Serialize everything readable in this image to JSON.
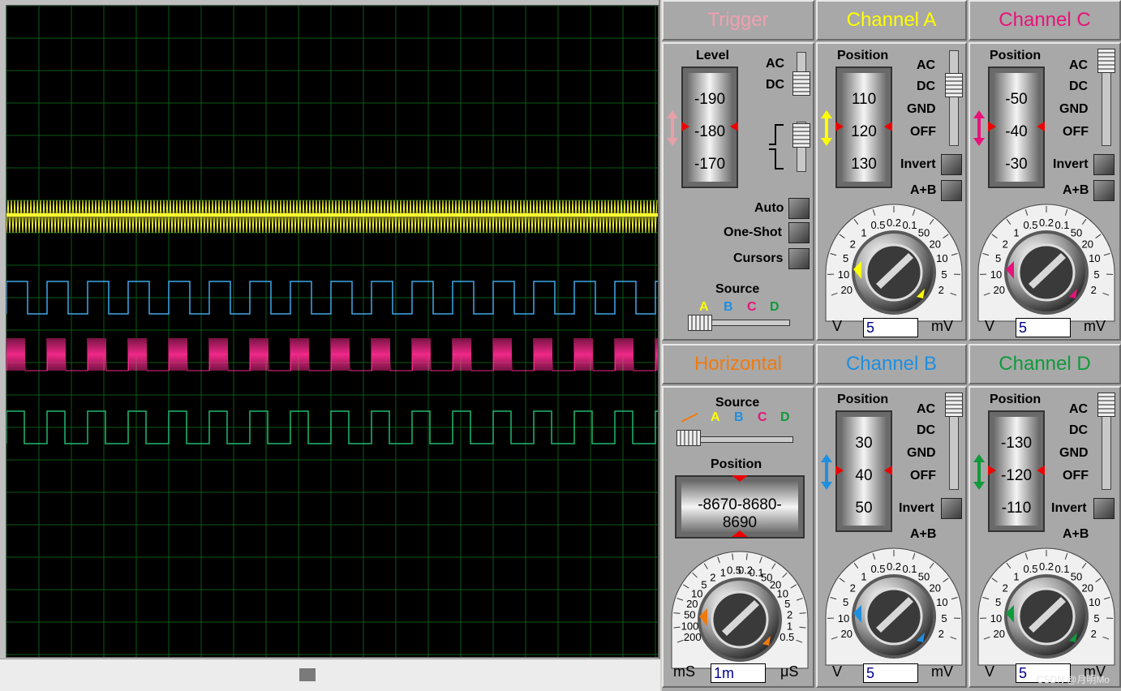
{
  "trigger": {
    "title": "Trigger",
    "level_label": "Level",
    "drum_values": [
      "-190",
      "-180",
      "-170"
    ],
    "coupling": [
      "AC",
      "DC"
    ],
    "buttons": [
      "Auto",
      "One-Shot",
      "Cursors"
    ],
    "source_label": "Source",
    "sources": [
      "A",
      "B",
      "C",
      "D"
    ]
  },
  "horizontal": {
    "title": "Horizontal",
    "source_label": "Source",
    "sources": [
      "A",
      "B",
      "C",
      "D"
    ],
    "position_label": "Position",
    "position_readout": "-8670-8680-8690",
    "dial_labels": [
      "200",
      "100",
      "50",
      "20",
      "10",
      "5",
      "2",
      "1",
      "0.5",
      "0.2",
      "0.1",
      "50",
      "20",
      "10",
      "5",
      "2",
      "1",
      "0.5"
    ],
    "unit_left": "mS",
    "unit_right": "μS",
    "value": "1m"
  },
  "channels": [
    {
      "name": "Channel A",
      "color": "#ffff00",
      "position_label": "Position",
      "drum_values": [
        "110",
        "120",
        "130"
      ],
      "coupling": [
        "AC",
        "DC",
        "GND",
        "OFF"
      ],
      "invert": "Invert",
      "aplusb": "A+B",
      "dial_labels": [
        "20",
        "10",
        "5",
        "2",
        "1",
        "0.5",
        "0.2",
        "0.1",
        "50",
        "20",
        "10",
        "5",
        "2"
      ],
      "unit_left": "V",
      "unit_right": "mV",
      "value": "5"
    },
    {
      "name": "Channel C",
      "color": "#e8127a",
      "position_label": "Position",
      "drum_values": [
        "-50",
        "-40",
        "-30"
      ],
      "coupling": [
        "AC",
        "DC",
        "GND",
        "OFF"
      ],
      "invert": "Invert",
      "aplusb": "A+B",
      "dial_labels": [
        "20",
        "10",
        "5",
        "2",
        "1",
        "0.5",
        "0.2",
        "0.1",
        "50",
        "20",
        "10",
        "5",
        "2"
      ],
      "unit_left": "V",
      "unit_right": "mV",
      "value": "5"
    },
    {
      "name": "Channel B",
      "color": "#1e8fe0",
      "position_label": "Position",
      "drum_values": [
        "30",
        "40",
        "50"
      ],
      "coupling": [
        "AC",
        "DC",
        "GND",
        "OFF"
      ],
      "invert": "Invert",
      "aplusb": "A+B",
      "dial_labels": [
        "20",
        "10",
        "5",
        "2",
        "1",
        "0.5",
        "0.2",
        "0.1",
        "50",
        "20",
        "10",
        "5",
        "2"
      ],
      "unit_left": "V",
      "unit_right": "mV",
      "value": "5"
    },
    {
      "name": "Channel D",
      "color": "#0f9a3c",
      "position_label": "Position",
      "drum_values": [
        "-130",
        "-120",
        "-110"
      ],
      "coupling": [
        "AC",
        "DC",
        "GND",
        "OFF"
      ],
      "invert": "Invert",
      "aplusb": "A+B",
      "dial_labels": [
        "20",
        "10",
        "5",
        "2",
        "1",
        "0.5",
        "0.2",
        "0.1",
        "50",
        "20",
        "10",
        "5",
        "2"
      ],
      "unit_left": "V",
      "unit_right": "mV",
      "value": "5"
    }
  ],
  "colors": {
    "trigger_title": "#f0a0b0",
    "horizontal_title": "#f07a10",
    "trace_a": "#ffff33",
    "trace_b": "#3fa8e8",
    "trace_c": "#f02888",
    "trace_d": "#20b870",
    "grid": "#0a5a14"
  },
  "watermark": "CSDN @月明Mo"
}
